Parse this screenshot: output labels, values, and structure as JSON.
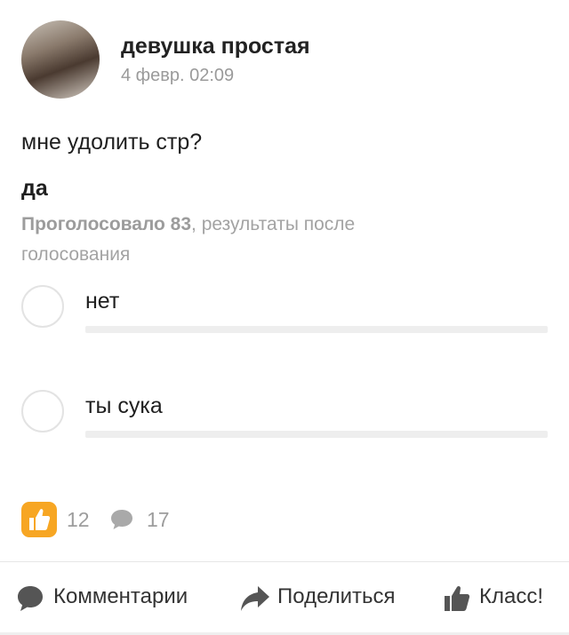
{
  "author": {
    "name": "девушка простая",
    "date": "4 февр. 02:09"
  },
  "post": {
    "text": "мне удолить стр?"
  },
  "poll": {
    "question": "да",
    "votes_label": "Проголосовало 83",
    "results_note": ", результаты после голосования",
    "options": [
      {
        "label": "нет"
      },
      {
        "label": "ты сука"
      }
    ]
  },
  "stats": {
    "likes": "12",
    "comments": "17"
  },
  "actions": {
    "comments_label": "Комментарии",
    "share_label": "Поделиться",
    "like_label": "Класс!"
  },
  "colors": {
    "accent": "#f7a623",
    "muted_text": "#9a9a9a",
    "track": "#eeeeee"
  },
  "icons": [
    "comment-icon",
    "share-icon",
    "thumbs-up-icon"
  ]
}
